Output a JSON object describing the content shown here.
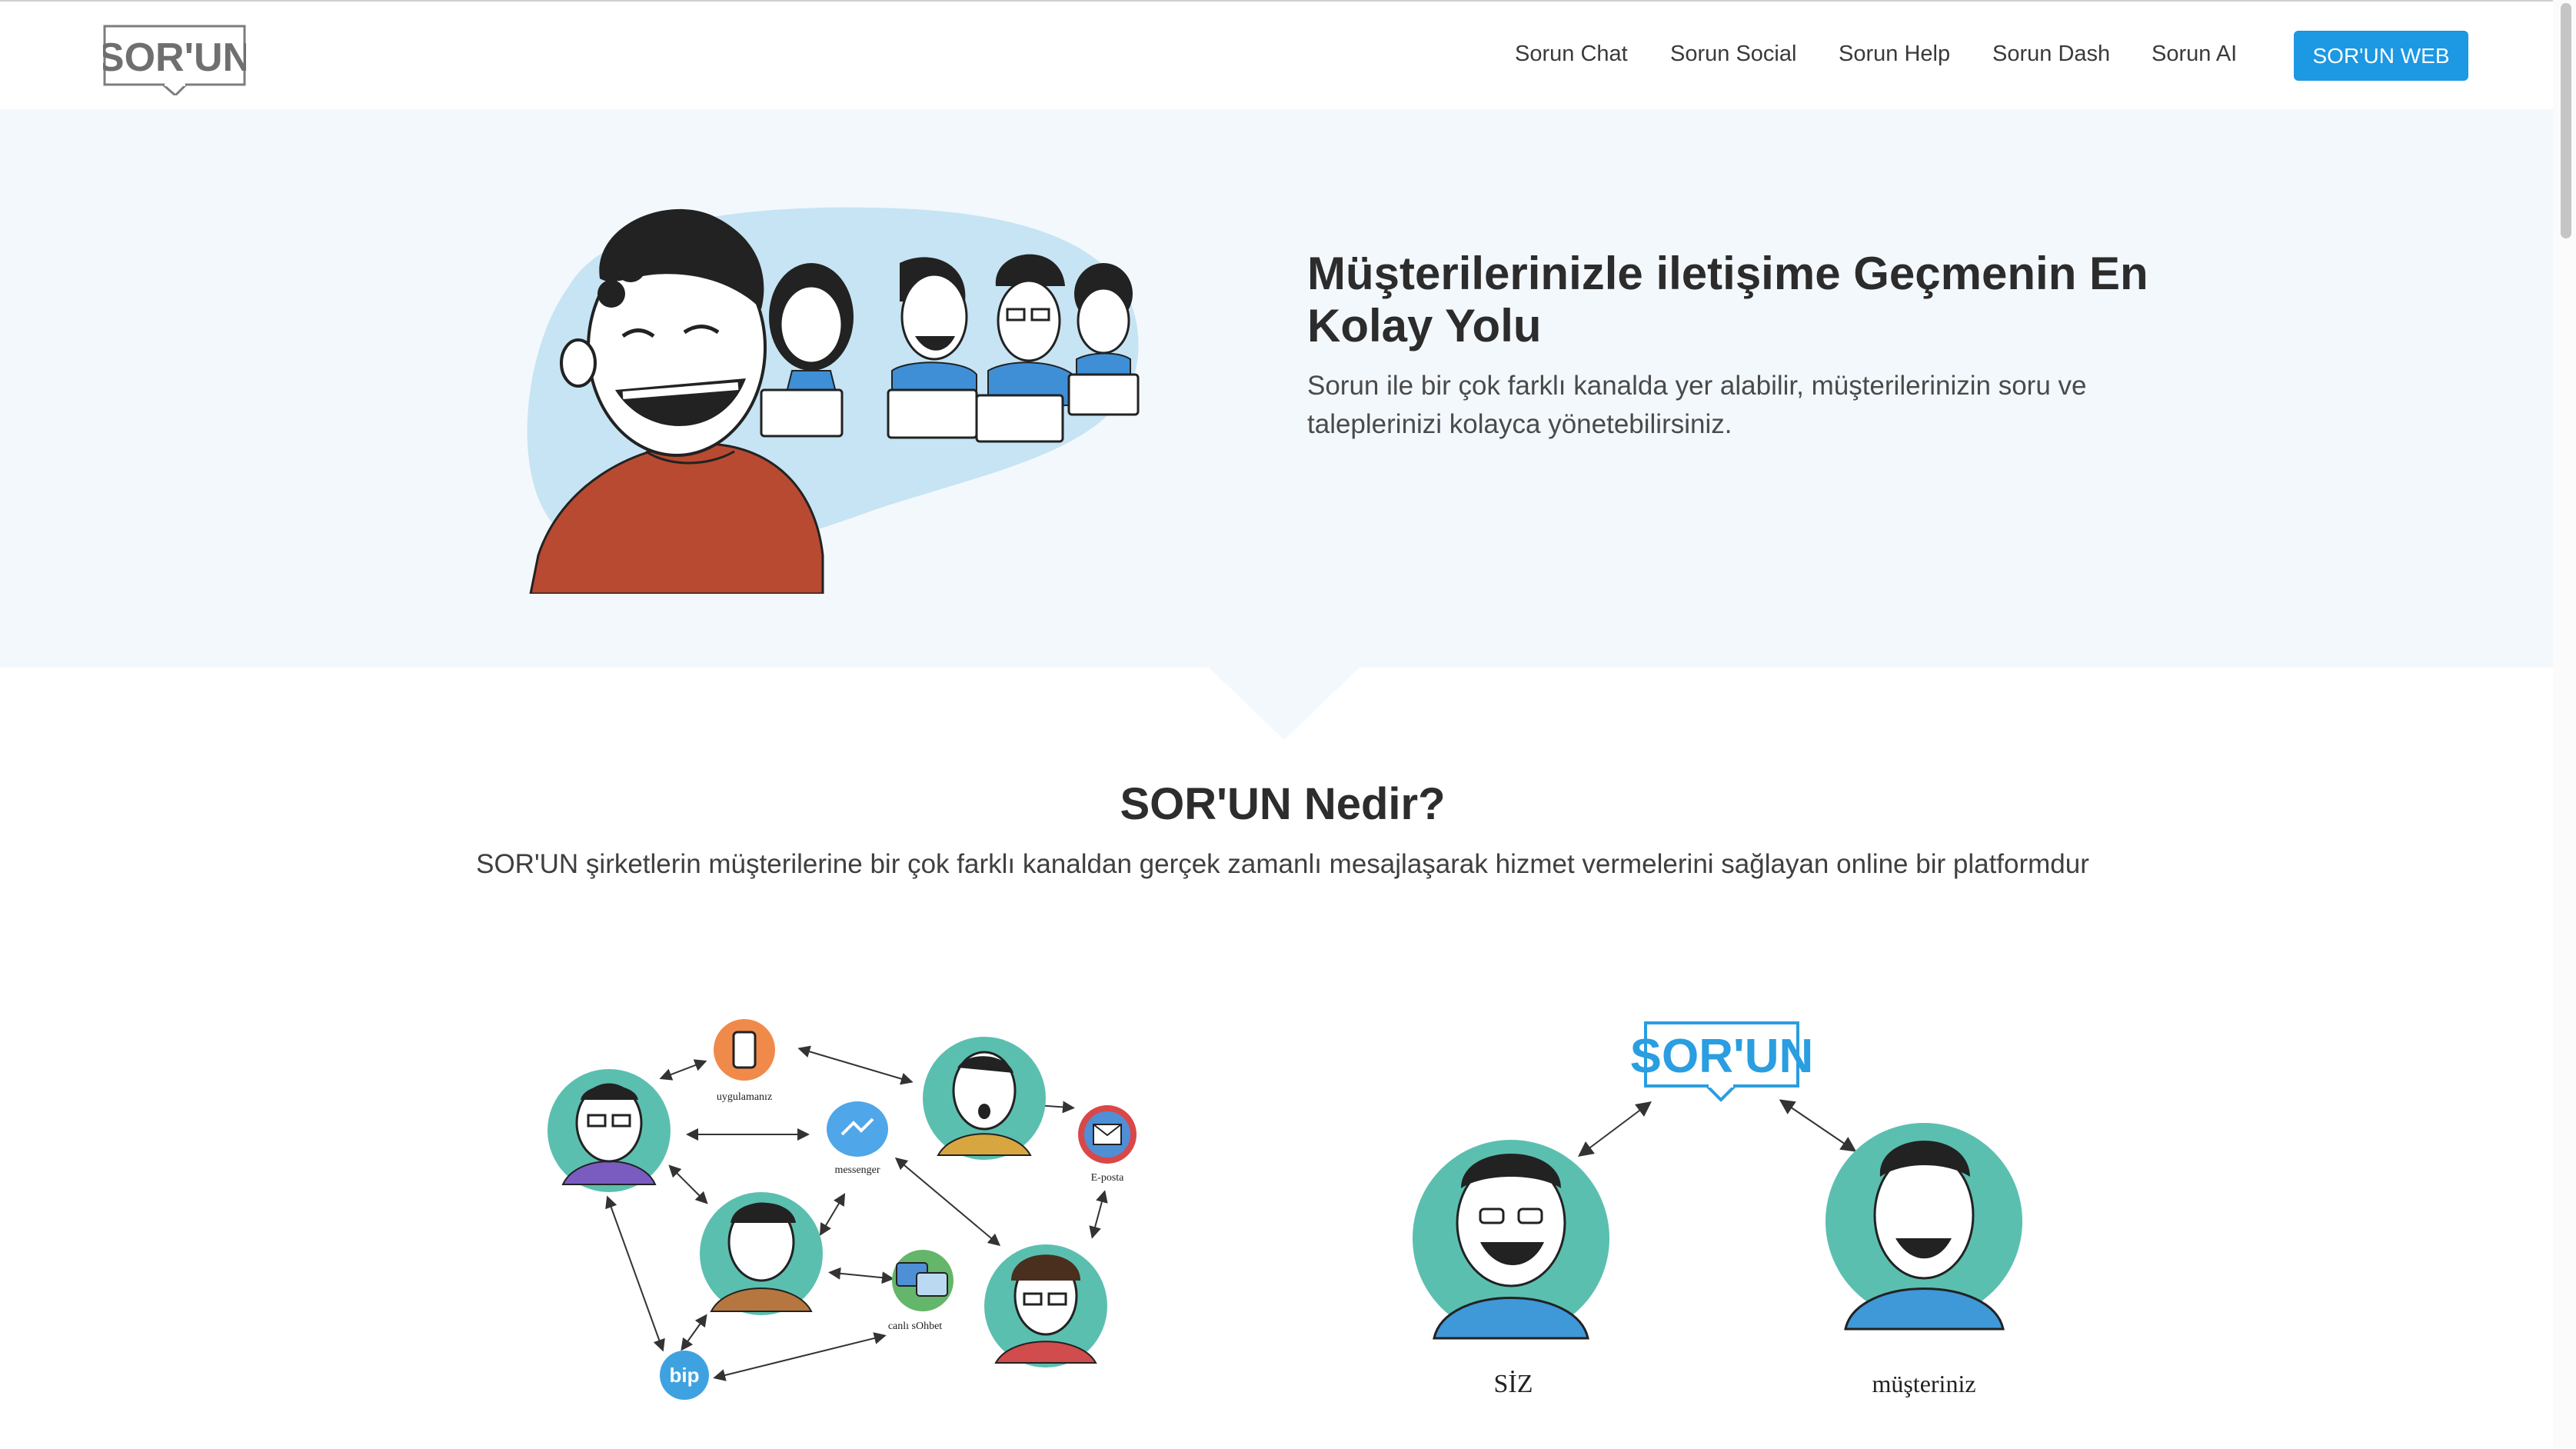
{
  "header": {
    "logo_text": "SOR'UN",
    "nav": [
      {
        "label": "Sorun Chat"
      },
      {
        "label": "Sorun Social"
      },
      {
        "label": "Sorun Help"
      },
      {
        "label": "Sorun Dash"
      },
      {
        "label": "Sorun AI"
      }
    ],
    "cta_label": "SOR'UN WEB"
  },
  "hero": {
    "title": "Müşterilerinizle iletişime Geçmenin En Kolay Yolu",
    "subtitle": "Sorun ile bir çok farklı kanalda yer alabilir, müşterilerinizin soru ve taleplerinizi kolayca yönetebilirsiniz."
  },
  "about": {
    "title": "SOR'UN Nedir?",
    "description": "SOR'UN şirketlerin müşterilerine bir çok farklı kanaldan gerçek zamanlı mesajlaşarak hizmet vermelerini sağlayan online bir platformdur"
  },
  "network_illustration": {
    "labels": {
      "app": "uygulamanız",
      "messenger": "messenger",
      "email": "E-posta",
      "live_chat": "canlı sOhbet",
      "bip": "bip"
    }
  },
  "sorun_illustration": {
    "logo_text": "SOR'UN",
    "left_label": "SİZ",
    "right_label": "müşteriniz"
  },
  "colors": {
    "accent": "#1d98e2",
    "hero_bg": "#f3f8fc",
    "teal": "#5bbfb0",
    "hero_blob": "#c6e4f3",
    "shirt_red": "#b84a31"
  }
}
